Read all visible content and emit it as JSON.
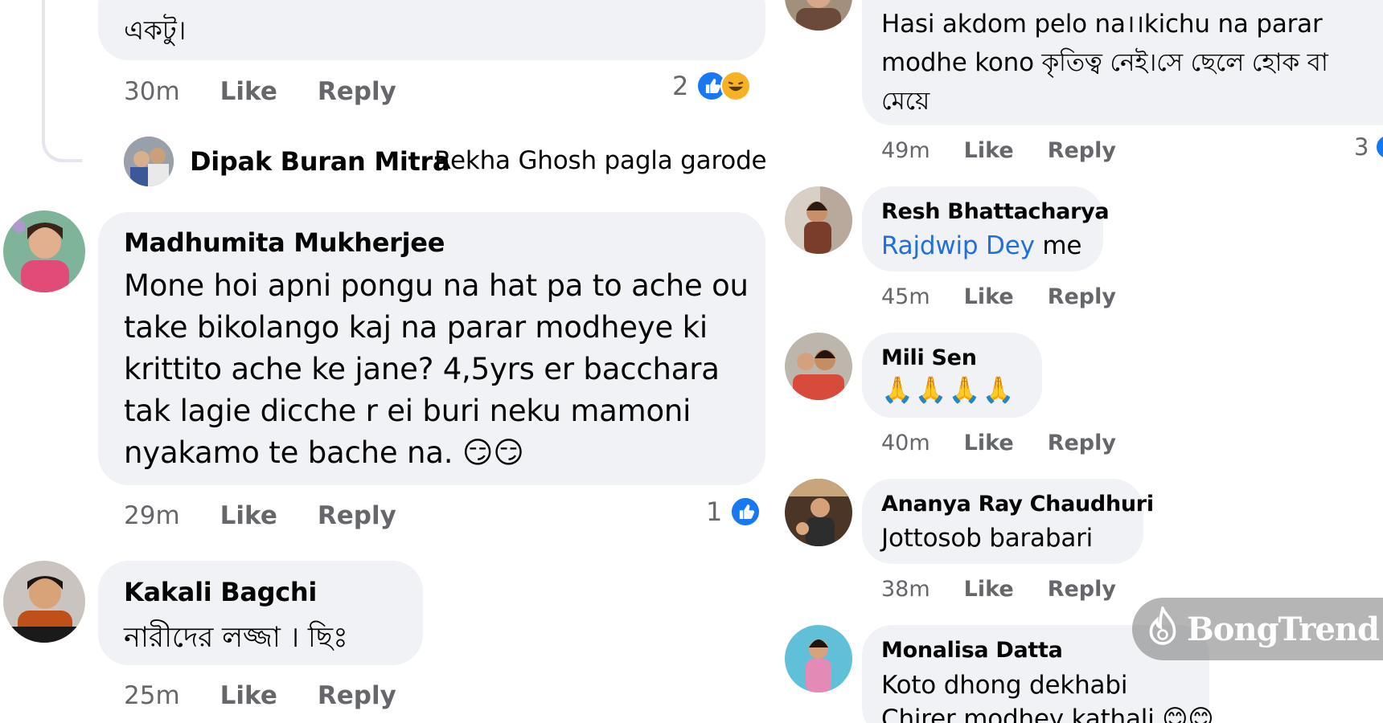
{
  "left": {
    "c0": {
      "text": "একটু।",
      "time": "30m",
      "like": "Like",
      "reply": "Reply",
      "react_count": "2"
    },
    "c1": {
      "author": "Dipak Buran Mitra",
      "text": "Rekha Ghosh pagla garode"
    },
    "c2": {
      "author": "Madhumita Mukherjee",
      "lines": [
        "Mone hoi apni pongu na hat pa to ache ou",
        "take bikolango kaj na parar modheye ki",
        "krittito ache ke jane? 4,5yrs er bacchara",
        "tak lagie dicche r ei buri neku mamoni",
        "nyakamo te bache na. 😏😏"
      ],
      "time": "29m",
      "like": "Like",
      "reply": "Reply",
      "react_count": "1"
    },
    "c3": {
      "author": "Kakali Bagchi",
      "text": "নারীদের লজ্জা । ছিঃ",
      "time": "25m",
      "like": "Like",
      "reply": "Reply"
    }
  },
  "right": {
    "r0": {
      "lines": [
        "Hasi akdom pelo na।।kichu na parar",
        "modhe kono কৃতিত্ব নেই।সে ছেলে হোক বা",
        "মেয়ে"
      ],
      "time": "49m",
      "like": "Like",
      "reply": "Reply",
      "react_count": "3"
    },
    "r1": {
      "author": "Resh Bhattacharya",
      "mention": "Rajdwip Dey",
      "text": " me",
      "time": "45m",
      "like": "Like",
      "reply": "Reply"
    },
    "r2": {
      "author": "Mili Sen",
      "text": "🙏🙏🙏🙏",
      "time": "40m",
      "like": "Like",
      "reply": "Reply"
    },
    "r3": {
      "author": "Ananya Ray Chaudhuri",
      "text": "Jottosob barabari",
      "time": "38m",
      "like": "Like",
      "reply": "Reply"
    },
    "r4": {
      "author": "Monalisa Datta",
      "lines": [
        "Koto dhong dekhabi",
        "Chirer modhey kathali 😊😊"
      ]
    }
  },
  "watermark": {
    "brand": "BongTrend"
  },
  "colors": {
    "bubble": "#f0f2f5",
    "meta": "#65676b",
    "mention": "#216fdb",
    "like": "#1877f2",
    "haha": "#f7b125"
  }
}
